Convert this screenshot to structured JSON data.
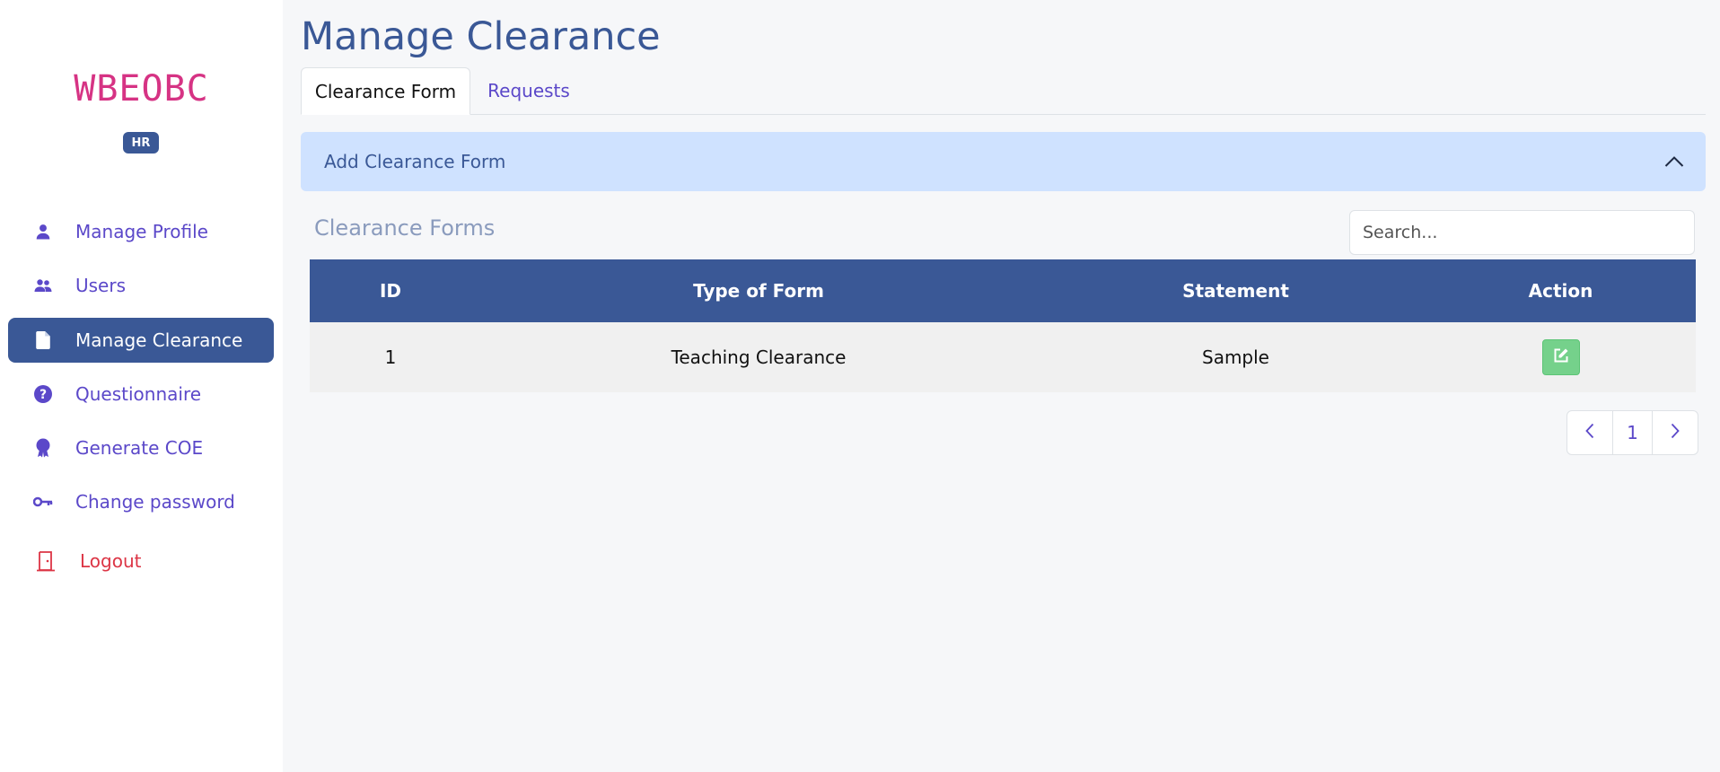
{
  "brand": {
    "logo_text": "WBEOBC",
    "role_badge": "HR",
    "logo_color": "#d63384"
  },
  "sidebar": {
    "items": [
      {
        "label": "Manage Profile",
        "icon": "user-icon",
        "active": false
      },
      {
        "label": "Users",
        "icon": "users-icon",
        "active": false
      },
      {
        "label": "Manage Clearance",
        "icon": "file-icon",
        "active": true
      },
      {
        "label": "Questionnaire",
        "icon": "question-circle-icon",
        "active": false
      },
      {
        "label": "Generate COE",
        "icon": "award-icon",
        "active": false
      },
      {
        "label": "Change password",
        "icon": "key-icon",
        "active": false
      }
    ],
    "logout_label": "Logout",
    "logout_icon": "door-icon"
  },
  "page": {
    "title": "Manage Clearance",
    "tabs": [
      {
        "label": "Clearance Form",
        "active": true
      },
      {
        "label": "Requests",
        "active": false
      }
    ]
  },
  "accordion": {
    "label": "Add Clearance Form",
    "icon": "chevron-up-icon",
    "expanded": true
  },
  "forms": {
    "section_title": "Clearance Forms",
    "search": {
      "placeholder": "Search...",
      "value": ""
    },
    "columns": [
      "ID",
      "Type of Form",
      "Statement",
      "Action"
    ],
    "rows": [
      {
        "id": "1",
        "type": "Teaching Clearance",
        "statement": "Sample",
        "action_icon": "edit-icon"
      }
    ]
  },
  "pagination": {
    "prev_icon": "chevron-left-icon",
    "current_page": "1",
    "next_icon": "chevron-right-icon"
  },
  "colors": {
    "primary": "#3a5896",
    "link": "#5b48c9",
    "danger": "#dc3545",
    "accordion_bg": "#cfe2ff",
    "edit_button": "#75d18b"
  }
}
